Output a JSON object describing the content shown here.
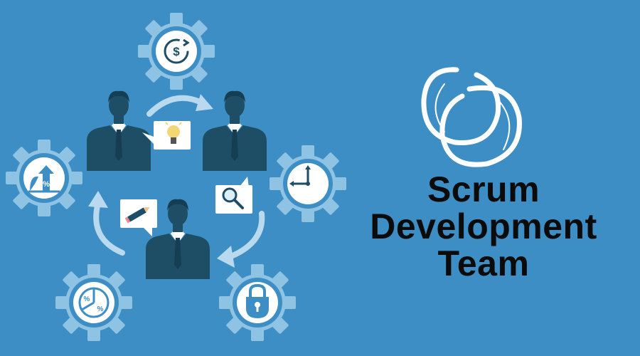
{
  "title": {
    "line1": "Scrum",
    "line2": "Development",
    "line3": "Team"
  },
  "colors": {
    "background": "#3d8ec4",
    "gear_outer": "#8ec3e3",
    "gear_inner": "#3d8ec4",
    "gear_core": "#ffffff",
    "person": "#1d4e66",
    "arrow": "#b9daee",
    "title_text": "#0b0b0b"
  },
  "icons": [
    "dollar-cycle-icon",
    "growth-percent-icon",
    "pie-chart-icon",
    "padlock-icon",
    "clock-icon",
    "lightbulb-icon",
    "magnifier-icon",
    "pencil-icon",
    "enso-circle-logo"
  ]
}
